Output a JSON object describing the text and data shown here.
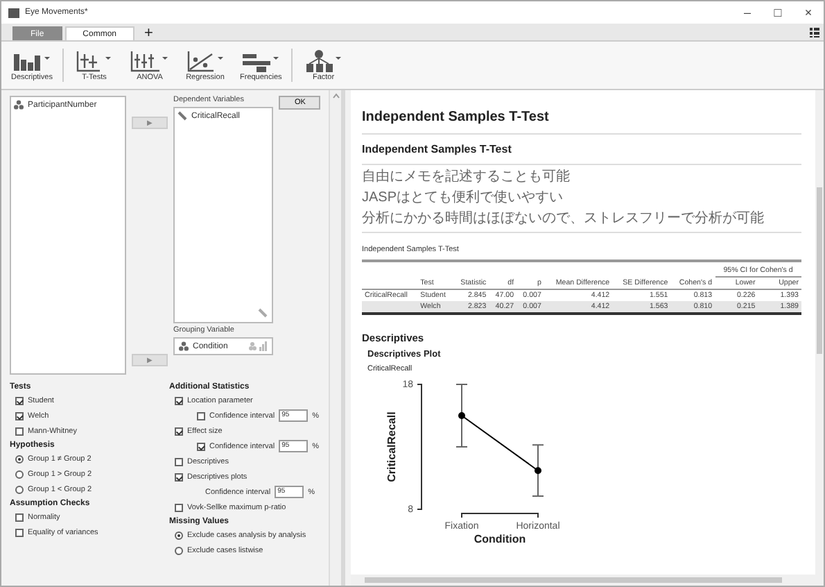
{
  "window": {
    "title": "Eye Movements*",
    "controls": [
      "–",
      "□",
      "×"
    ]
  },
  "tabs": [
    {
      "label": "File",
      "kind": "file",
      "selected": false
    },
    {
      "label": "Common",
      "kind": "tab",
      "selected": true
    }
  ],
  "add_tab": "+",
  "ribbon": [
    {
      "label": "Descriptives",
      "kind": "bars"
    },
    {
      "label": "T-Tests",
      "kind": "ttest"
    },
    {
      "label": "ANOVA",
      "kind": "anova"
    },
    {
      "label": "Regression",
      "kind": "scatter"
    },
    {
      "label": "Frequencies",
      "kind": "freq"
    },
    {
      "label": "Factor",
      "kind": "factor"
    }
  ],
  "variables": {
    "available": [
      "ParticipantNumber"
    ],
    "dependent_label": "Dependent Variables",
    "dependent": [
      "CriticalRecall"
    ],
    "grouping_label": "Grouping Variable",
    "grouping": "Condition",
    "ok": "OK",
    "move": [
      "▶",
      "▶"
    ]
  },
  "options_left": [
    {
      "title": "Tests",
      "items": [
        {
          "kind": "checkbox",
          "label": "Student",
          "checked": true
        },
        {
          "kind": "checkbox",
          "label": "Welch",
          "checked": true
        },
        {
          "kind": "checkbox",
          "label": "Mann-Whitney",
          "checked": false
        }
      ]
    },
    {
      "title": "Hypothesis",
      "items": [
        {
          "kind": "radio",
          "label": "Group 1 ≠ Group 2",
          "checked": true
        },
        {
          "kind": "radio",
          "label": "Group 1 > Group 2",
          "checked": false
        },
        {
          "kind": "radio",
          "label": "Group 1 < Group 2",
          "checked": false
        }
      ]
    },
    {
      "title": "Assumption Checks",
      "items": [
        {
          "kind": "checkbox",
          "label": "Normality",
          "checked": false
        },
        {
          "kind": "checkbox",
          "label": "Equality of variances",
          "checked": false
        }
      ]
    }
  ],
  "options_right": [
    {
      "title": "Additional Statistics",
      "items": [
        {
          "kind": "checkbox",
          "label": "Location parameter",
          "checked": true,
          "children": [
            {
              "kind": "checkbox",
              "label": "Confidence interval",
              "checked": false,
              "value": "95",
              "unit": "%"
            }
          ]
        },
        {
          "kind": "checkbox",
          "label": "Effect size",
          "checked": true,
          "children": [
            {
              "kind": "checkbox",
              "label": "Confidence interval",
              "checked": true,
              "value": "95",
              "unit": "%"
            }
          ]
        },
        {
          "kind": "checkbox",
          "label": "Descriptives",
          "checked": false
        },
        {
          "kind": "checkbox",
          "label": "Descriptives plots",
          "checked": true,
          "children": [
            {
              "kind": "field",
              "label": "Confidence interval",
              "value": "95",
              "unit": "%"
            }
          ]
        },
        {
          "kind": "checkbox",
          "label": "Vovk-Sellke maximum p-ratio",
          "checked": false
        }
      ]
    },
    {
      "title": "Missing Values",
      "items": [
        {
          "kind": "radio",
          "label": "Exclude cases analysis by analysis",
          "checked": true
        },
        {
          "kind": "radio",
          "label": "Exclude cases listwise",
          "checked": false
        }
      ]
    }
  ],
  "output": {
    "title": "Independent Samples T-Test",
    "heading": "Independent Samples T-Test",
    "notes": [
      "自由にメモを記述することも可能",
      "JASPはとても便利で使いやすい",
      "分析にかかる時間はほぼないので、ストレスフリーで分析が可能"
    ],
    "table": {
      "caption": "Independent Samples T-Test",
      "group_header": "95% CI for Cohen's d",
      "columns": [
        "Test",
        "Statistic",
        "df",
        "p",
        "Mean Difference",
        "SE Difference",
        "Cohen's d",
        "Lower",
        "Upper"
      ],
      "rows": [
        {
          "variable": "CriticalRecall",
          "selected": false,
          "cells": [
            "Student",
            "2.845",
            "47.00",
            "0.007",
            "4.412",
            "1.551",
            "0.813",
            "0.226",
            "1.393"
          ]
        },
        {
          "selected": true,
          "cells": [
            "Welch",
            "2.823",
            "40.27",
            "0.007",
            "4.412",
            "1.563",
            "0.810",
            "0.215",
            "1.389"
          ]
        }
      ]
    },
    "descriptives": "Descriptives",
    "plot_heading": "Descriptives Plot",
    "chart_data": {
      "type": "line",
      "xlabel": "Condition",
      "ylabel": "CriticalRecall",
      "categories": [
        "Fixation",
        "Horizontal"
      ],
      "series": [
        {
          "name": "CriticalRecall",
          "color": "#000000",
          "marker": "circle",
          "values": [
            15.5,
            11.1
          ],
          "errors": [
            2.5,
            2.05
          ]
        }
      ],
      "ylim": [
        8,
        18
      ],
      "yticks": [
        8,
        18
      ]
    }
  }
}
